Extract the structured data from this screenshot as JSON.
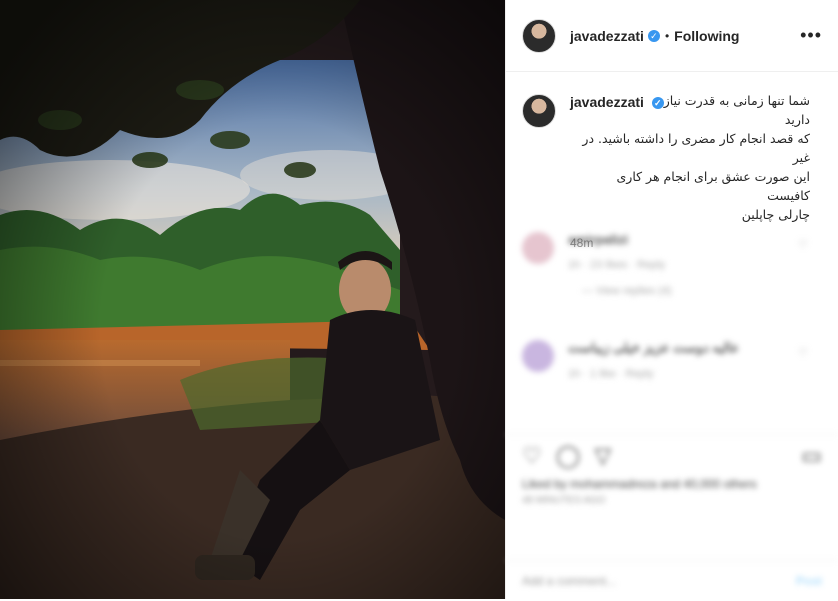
{
  "post": {
    "username": "javadezzati",
    "follow_status": "Following",
    "dot": "•",
    "verified_mark": "✓",
    "more_icon": "more-options-icon",
    "caption": "شما تنها زمانی به قدرت نیاز\nدارید\nکه قصد انجام کار مضری را داشته باشید. در غیر\nاین صورت عشق برای انجام هر کاری کافیست\nچارلی چاپلین",
    "time_ago": "48m"
  },
  "comments": [
    {
      "user": "amirpalizi",
      "meta": "1h · 23 likes · Reply",
      "replies": "— View replies (4)"
    },
    {
      "user": "عالیه دوست عزیز خیلی زیباست",
      "meta": "1h · 1 like · Reply",
      "replies": ""
    }
  ],
  "footer": {
    "likes_text": "Liked by mohammadreza and 40,000 others",
    "ago": "48 MINUTES AGO",
    "add_comment": "Add a comment...",
    "post": "Post"
  },
  "colors": {
    "accent": "#3897f0",
    "border": "#efefef"
  }
}
